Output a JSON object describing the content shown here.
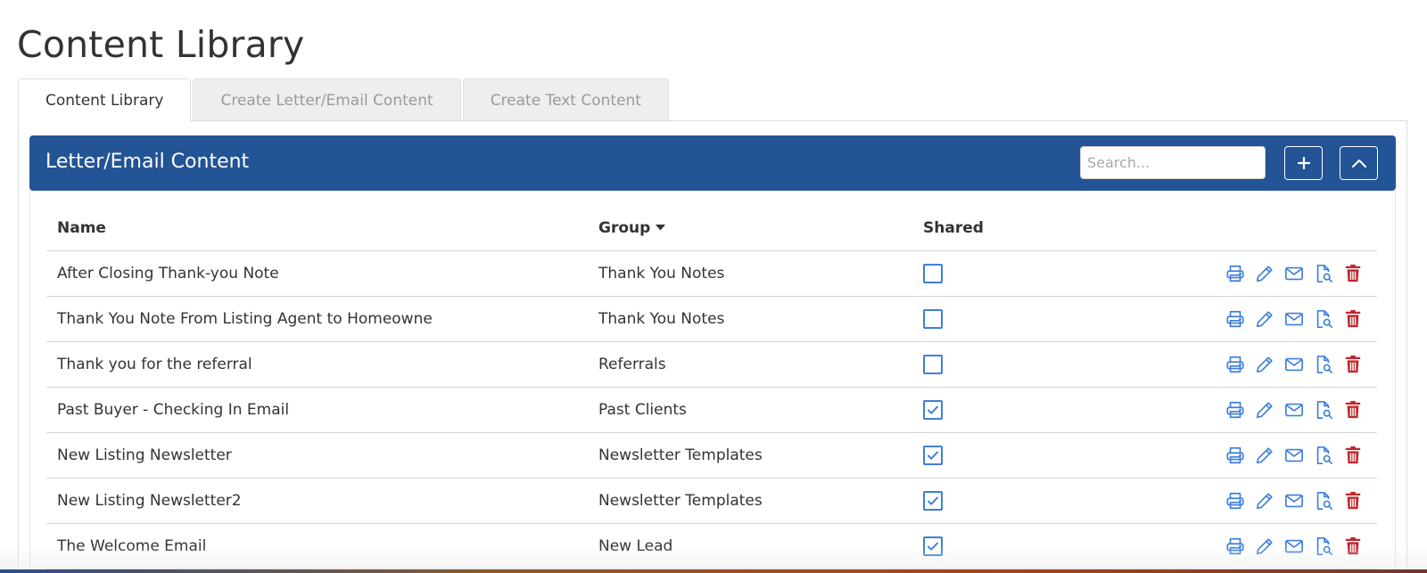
{
  "page": {
    "title": "Content Library"
  },
  "tabs": [
    {
      "label": "Content Library",
      "active": true
    },
    {
      "label": "Create Letter/Email Content",
      "active": false
    },
    {
      "label": "Create Text Content",
      "active": false
    }
  ],
  "panel": {
    "title": "Letter/Email Content",
    "search_placeholder": "Search...",
    "add_icon": "plus-icon",
    "collapse_icon": "chevron-up-icon",
    "header_color": "#235495"
  },
  "table": {
    "columns": {
      "name": "Name",
      "group": "Group",
      "shared": "Shared"
    },
    "sort_icon": "caret-down-icon",
    "rows": [
      {
        "name": "After Closing Thank-you Note",
        "group": "Thank You Notes",
        "shared": false
      },
      {
        "name": "Thank You Note From Listing Agent to Homeowne",
        "group": "Thank You Notes",
        "shared": false
      },
      {
        "name": "Thank you for the referral",
        "group": "Referrals",
        "shared": false
      },
      {
        "name": "Past Buyer - Checking In Email",
        "group": "Past Clients",
        "shared": true
      },
      {
        "name": "New Listing Newsletter",
        "group": "Newsletter Templates",
        "shared": true
      },
      {
        "name": "New Listing Newsletter2",
        "group": "Newsletter Templates",
        "shared": true
      },
      {
        "name": "The Welcome Email",
        "group": "New Lead",
        "shared": true
      }
    ],
    "row_actions": [
      "print-icon",
      "pencil-icon",
      "envelope-icon",
      "file-search-icon",
      "trash-icon"
    ],
    "action_color": "#3d7fd9",
    "delete_color": "#c0262d"
  }
}
